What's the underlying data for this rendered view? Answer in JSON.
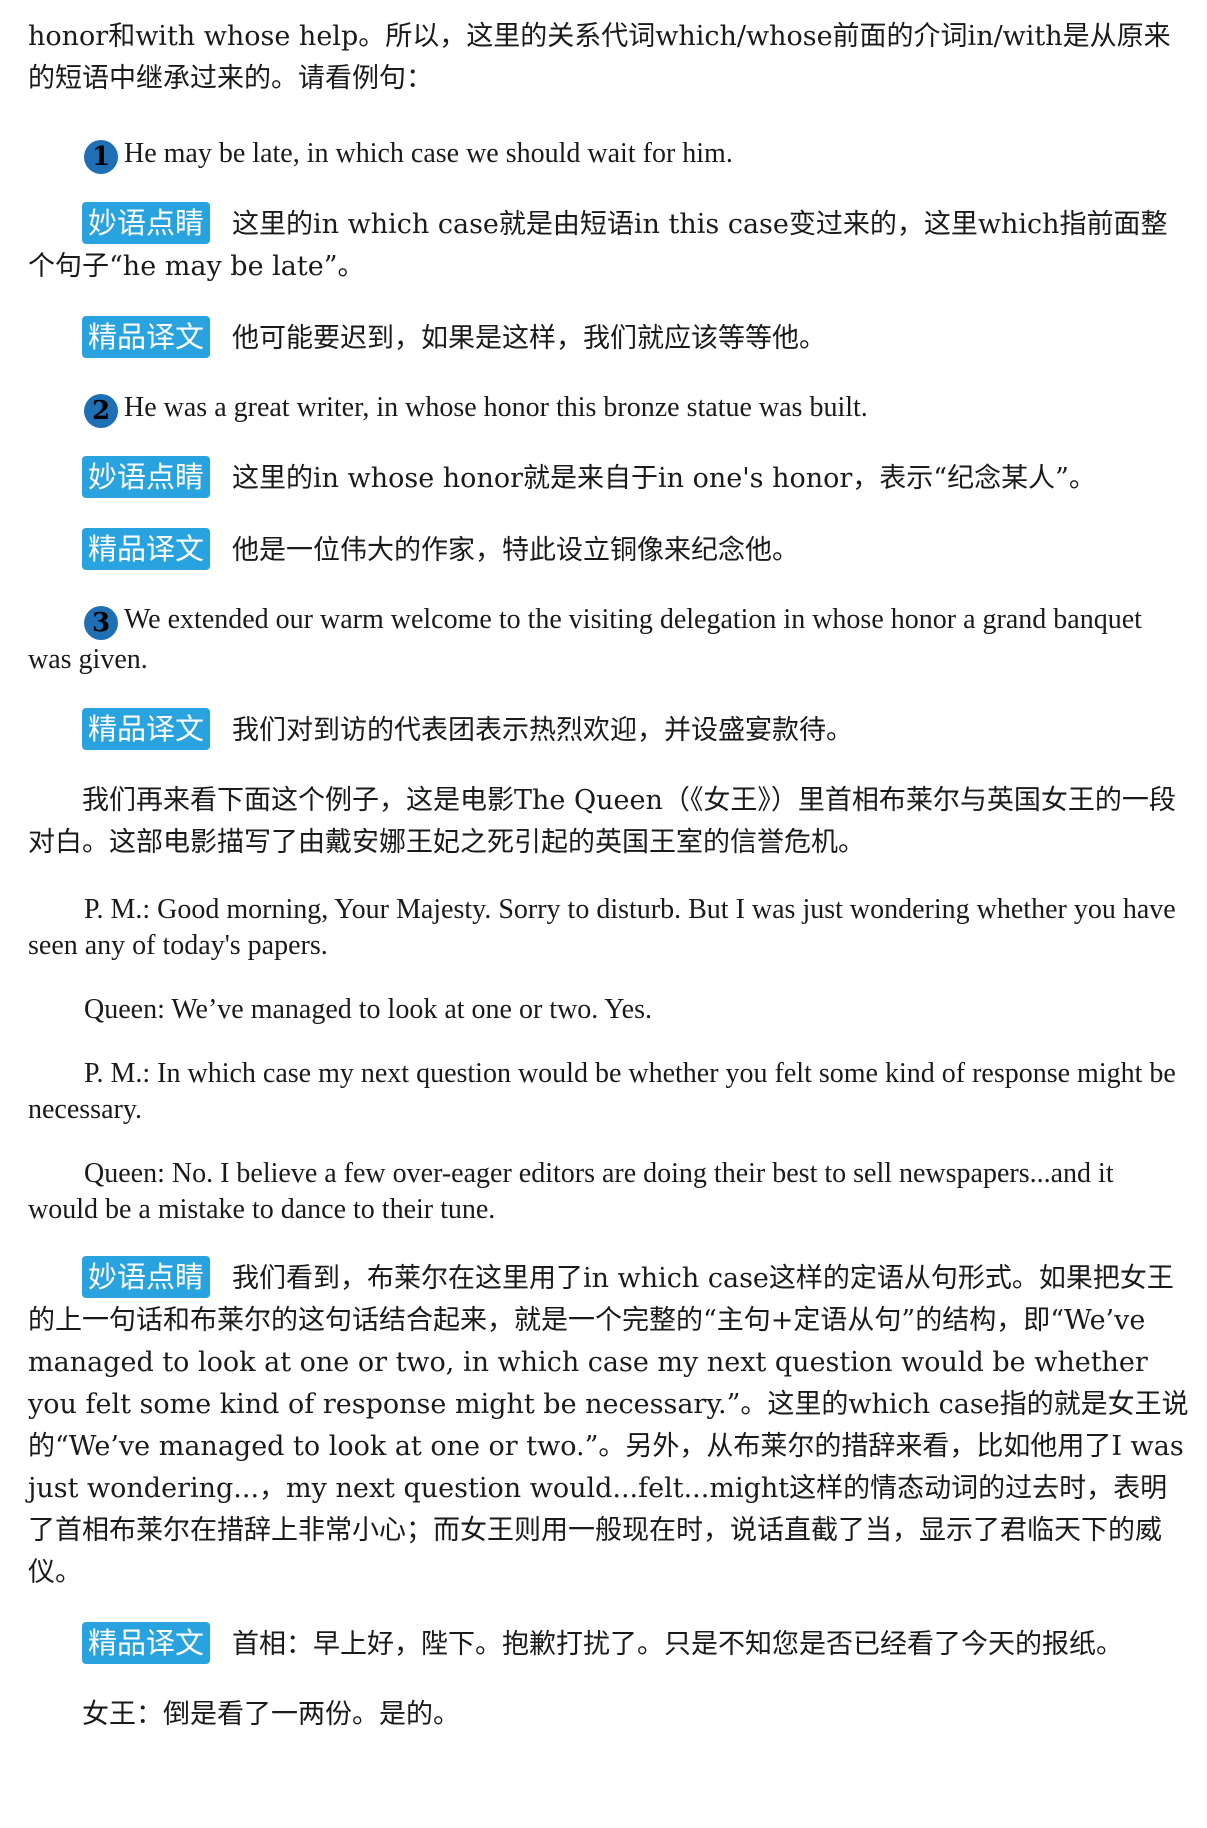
{
  "intro": {
    "text": "honor和with whose help。所以，这里的关系代词which/whose前面的介词in/with是从原来的短语中继承过来的。请看例句："
  },
  "tags": {
    "comment": "妙语点睛",
    "translation": "精品译文"
  },
  "examples": [
    {
      "num": "1",
      "sentence": "He may be late, in which case we should wait for him.",
      "comment": "这里的in which case就是由短语in this case变过来的，这里which指前面整个句子“he may be late”。",
      "translation": "他可能要迟到，如果是这样，我们就应该等等他。"
    },
    {
      "num": "2",
      "sentence": "He was a great writer, in whose honor this bronze statue was built.",
      "comment": "这里的in whose honor就是来自于in one's honor，表示“纪念某人”。",
      "translation": "他是一位伟大的作家，特此设立铜像来纪念他。"
    },
    {
      "num": "3",
      "sentence": "We extended our warm welcome to the visiting delegation in whose honor a grand banquet was given.",
      "translation": "我们对到访的代表团表示热烈欢迎，并设盛宴款待。"
    }
  ],
  "movie_intro": "我们再来看下面这个例子，这是电影The Queen（《女王》）里首相布莱尔与英国女王的一段对白。这部电影描写了由戴安娜王妃之死引起的英国王室的信誉危机。",
  "dialogue": [
    "P. M.: Good morning, Your Majesty. Sorry to disturb. But I was just wondering whether you have seen any of today's papers.",
    "Queen: We’ve managed to look at one or two. Yes.",
    "P. M.: In which case my next question would be whether you felt some kind of response might be necessary.",
    "Queen: No. I believe a few over-eager editors are doing their best to sell newspapers...and it would be a mistake to dance to their tune."
  ],
  "dialogue_comment": "我们看到，布莱尔在这里用了in which case这样的定语从句形式。如果把女王的上一句话和布莱尔的这句话结合起来，就是一个完整的“主句+定语从句”的结构，即“We’ve managed to look at one or two, in which case my next question would be whether you felt some kind of response might be necessary.”。这里的which case指的就是女王说的“We’ve managed to look at one or two.”。另外，从布莱尔的措辞来看，比如他用了I was just wondering...，my next question would...felt...might这样的情态动词的过去时，表明了首相布莱尔在措辞上非常小心；而女王则用一般现在时，说话直截了当，显示了君临天下的威仪。",
  "dialogue_translation": [
    "首相：早上好，陛下。抱歉打扰了。只是不知您是否已经看了今天的报纸。",
    "女王：倒是看了一两份。是的。"
  ]
}
